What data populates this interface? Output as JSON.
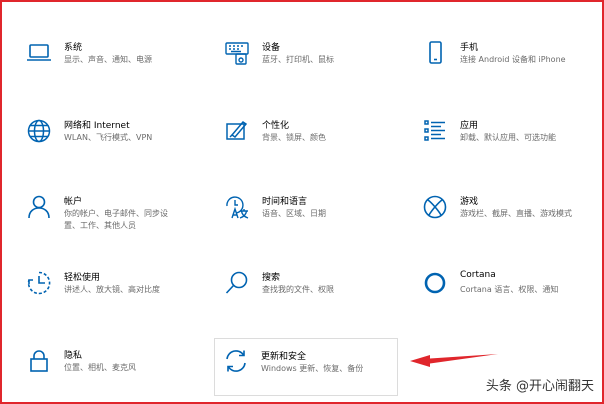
{
  "colors": {
    "accent": "#0063b1",
    "frame": "#e0262c",
    "arrow": "#e0262c"
  },
  "tiles": [
    {
      "title": "系统",
      "desc": [
        "显示、声音、通知、电源"
      ],
      "icon": "laptop-icon"
    },
    {
      "title": "设备",
      "desc": [
        "蓝牙、打印机、鼠标"
      ],
      "icon": "keyboard-speaker-icon"
    },
    {
      "title": "手机",
      "desc": [
        "连接 Android 设备和 iPhone"
      ],
      "icon": "phone-icon"
    },
    {
      "title": "网络和 Internet",
      "desc": [
        "WLAN、飞行模式、VPN"
      ],
      "icon": "globe-icon"
    },
    {
      "title": "个性化",
      "desc": [
        "背景、锁屏、颜色"
      ],
      "icon": "brush-icon"
    },
    {
      "title": "应用",
      "desc": [
        "卸载、默认应用、可选功能"
      ],
      "icon": "apps-list-icon"
    },
    {
      "title": "帐户",
      "desc": [
        "你的帐户、电子邮件、同步设",
        "置、工作、其他人员"
      ],
      "icon": "person-icon"
    },
    {
      "title": "时间和语言",
      "desc": [
        "语音、区域、日期"
      ],
      "icon": "time-language-icon"
    },
    {
      "title": "游戏",
      "desc": [
        "游戏栏、截屏、直播、游戏模式"
      ],
      "icon": "xbox-icon"
    },
    {
      "title": "轻松使用",
      "desc": [
        "讲述人、放大镜、高对比度"
      ],
      "icon": "ease-of-access-icon"
    },
    {
      "title": "搜索",
      "desc": [
        "查找我的文件、权限"
      ],
      "icon": "search-icon"
    },
    {
      "title": "Cortana",
      "desc": [
        "Cortana 语言、权限、通知"
      ],
      "icon": "cortana-icon"
    },
    {
      "title": "隐私",
      "desc": [
        "位置、相机、麦克风"
      ],
      "icon": "lock-icon"
    },
    {
      "title": "更新和安全",
      "desc": [
        "Windows 更新、恢复、备份"
      ],
      "icon": "sync-icon"
    }
  ],
  "watermark": "头条 @开心闹翻天"
}
